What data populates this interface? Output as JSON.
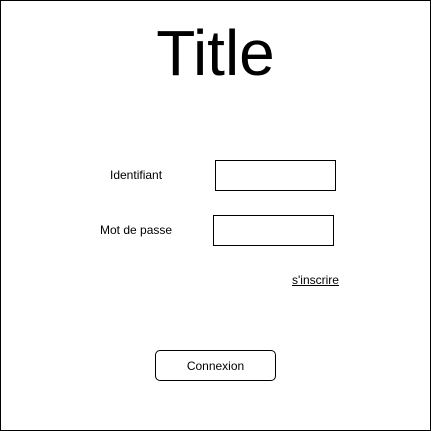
{
  "page": {
    "title": "Title"
  },
  "login_form": {
    "identifier_label": "Identifiant",
    "identifier_value": "",
    "password_label": "Mot de passe",
    "password_value": "",
    "register_link": "s'inscrire",
    "submit_label": "Connexion"
  }
}
